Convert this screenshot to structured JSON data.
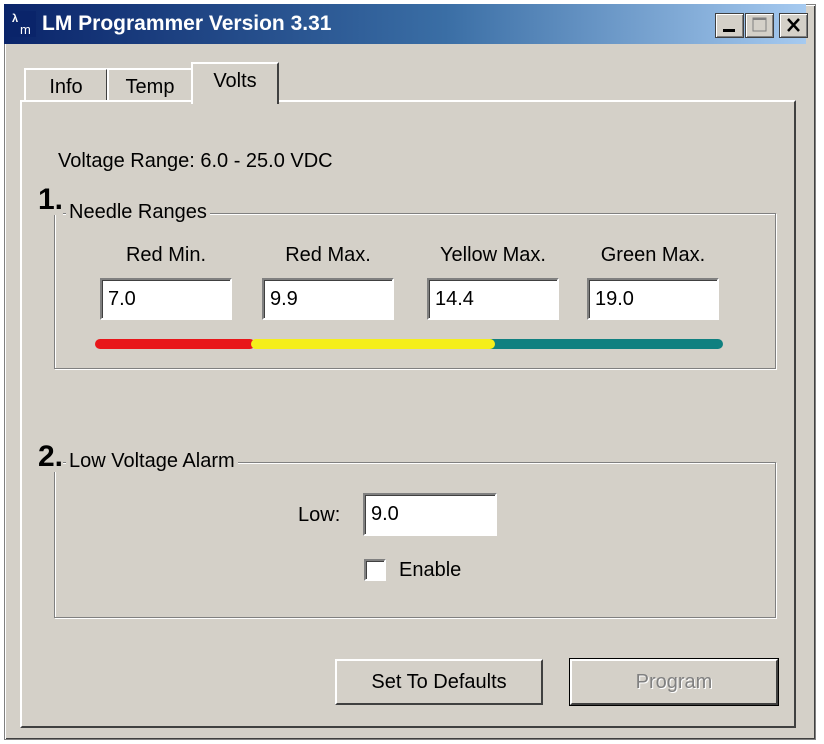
{
  "window": {
    "title": "LM Programmer Version 3.31",
    "icon": "lm-app-icon",
    "controls": [
      "minimize-icon",
      "maximize-icon",
      "close-icon"
    ]
  },
  "tabs": [
    {
      "label": "Info",
      "active": false
    },
    {
      "label": "Temp",
      "active": false
    },
    {
      "label": "Volts",
      "active": true
    }
  ],
  "volts": {
    "voltage_range": "Voltage Range: 6.0 - 25.0 VDC",
    "needle_ranges": {
      "step": "1.",
      "title": "Needle Ranges",
      "fields": [
        {
          "label": "Red Min.",
          "value": "7.0"
        },
        {
          "label": "Red Max.",
          "value": "9.9"
        },
        {
          "label": "Yellow Max.",
          "value": "14.4"
        },
        {
          "label": "Green Max.",
          "value": "19.0"
        }
      ],
      "range_bar": {
        "segments": [
          {
            "color": "#e8161a",
            "from": 6.0,
            "to": 9.9
          },
          {
            "color": "#f5ee1b",
            "from": 9.9,
            "to": 14.4
          },
          {
            "color": "#0f8080",
            "from": 14.4,
            "to": 19.0
          }
        ]
      }
    },
    "low_voltage_alarm": {
      "step": "2.",
      "title": "Low Voltage Alarm",
      "low_label": "Low:",
      "low_value": "9.0",
      "enable_label": "Enable",
      "enabled": false
    }
  },
  "buttons": {
    "defaults": "Set To Defaults",
    "program": "Program",
    "program_enabled": false
  }
}
